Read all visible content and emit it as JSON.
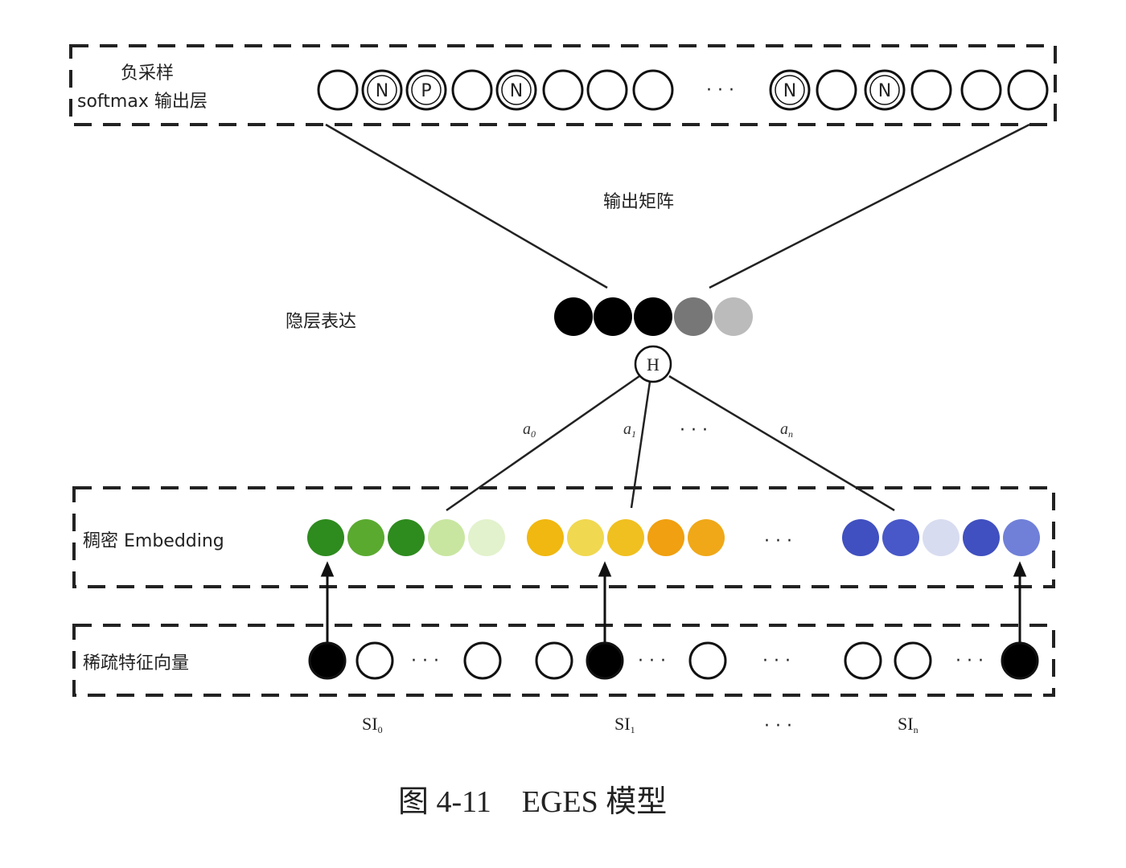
{
  "labels": {
    "negative_sampling": "负采样",
    "softmax_output": "softmax 输出层",
    "output_matrix": "输出矩阵",
    "hidden_layer": "隐层表达",
    "dense_embedding": "稠密 Embedding",
    "sparse_features": "稀疏特征向量",
    "hidden_node": "H",
    "weights": [
      {
        "base": "a",
        "sub": "0"
      },
      {
        "base": "a",
        "sub": "1"
      },
      {
        "base": "a",
        "sub": "n"
      }
    ],
    "side_info": [
      {
        "base": "SI",
        "sub": "0"
      },
      {
        "base": "SI",
        "sub": "1"
      },
      {
        "base": "SI",
        "sub": "n"
      }
    ],
    "ellipsis": "· · ·",
    "caption": "图 4-11　EGES 模型"
  },
  "output_layer": [
    "",
    "N",
    "P",
    "",
    "N",
    "",
    "",
    "",
    "...",
    "N",
    "",
    "N",
    "",
    "",
    ""
  ],
  "hidden_colors": [
    "#000000",
    "#000000",
    "#000000",
    "#777777",
    "#bbbbbb"
  ],
  "embedding_colors": {
    "green": [
      "#2e8b1e",
      "#5aaa30",
      "#2e8b1e",
      "#c8e6a0",
      "#e2f2cc"
    ],
    "yellow": [
      "#f0b810",
      "#f0d850",
      "#f0c020",
      "#f0a010",
      "#f0a818"
    ],
    "blue": [
      "#4050c0",
      "#4858c8",
      "#d8dcf0",
      "#4050c0",
      "#7080d8"
    ]
  },
  "sparse_nodes": [
    "filled",
    "empty",
    "...",
    "empty",
    "empty",
    "filled",
    "...",
    "empty",
    "...",
    "empty",
    "empty",
    "...",
    "filled"
  ]
}
